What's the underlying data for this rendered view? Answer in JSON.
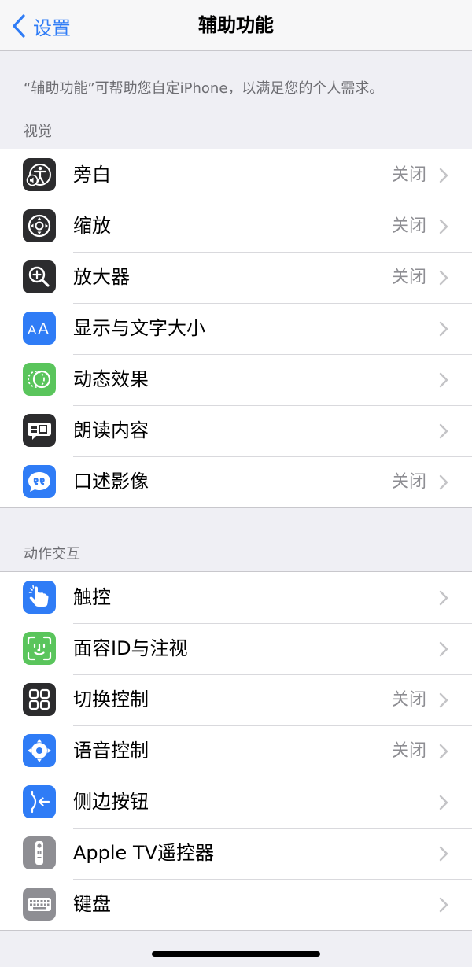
{
  "navbar": {
    "back_label": "设置",
    "title": "辅助功能"
  },
  "intro": "“辅助功能”可帮助您自定iPhone，以满足您的个人需求。",
  "sections": [
    {
      "header": "视觉",
      "items": [
        {
          "label": "旁白",
          "value": "关闭",
          "icon": "voiceover-icon",
          "color": "#2c2c2e"
        },
        {
          "label": "缩放",
          "value": "关闭",
          "icon": "zoom-icon",
          "color": "#2c2c2e"
        },
        {
          "label": "放大器",
          "value": "关闭",
          "icon": "magnifier-icon",
          "color": "#2c2c2e"
        },
        {
          "label": "显示与文字大小",
          "value": "",
          "icon": "text-size-icon",
          "color": "#2f7cf6"
        },
        {
          "label": "动态效果",
          "value": "",
          "icon": "motion-icon",
          "color": "#5ac55c"
        },
        {
          "label": "朗读内容",
          "value": "",
          "icon": "spoken-content-icon",
          "color": "#2c2c2e"
        },
        {
          "label": "口述影像",
          "value": "关闭",
          "icon": "audio-description-icon",
          "color": "#2f7cf6"
        }
      ]
    },
    {
      "header": "动作交互",
      "items": [
        {
          "label": "触控",
          "value": "",
          "icon": "touch-hand-icon",
          "color": "#2f7cf6"
        },
        {
          "label": "面容ID与注视",
          "value": "",
          "icon": "face-id-icon",
          "color": "#5ac55c"
        },
        {
          "label": "切换控制",
          "value": "关闭",
          "icon": "switch-control-icon",
          "color": "#2c2c2e"
        },
        {
          "label": "语音控制",
          "value": "关闭",
          "icon": "voice-control-icon",
          "color": "#2f7cf6"
        },
        {
          "label": "侧边按钮",
          "value": "",
          "icon": "side-button-icon",
          "color": "#2f7cf6"
        },
        {
          "label": "Apple TV遥控器",
          "value": "",
          "icon": "apple-tv-remote-icon",
          "color": "#8e8e93"
        },
        {
          "label": "键盘",
          "value": "",
          "icon": "keyboard-icon",
          "color": "#8e8e93"
        }
      ]
    }
  ]
}
